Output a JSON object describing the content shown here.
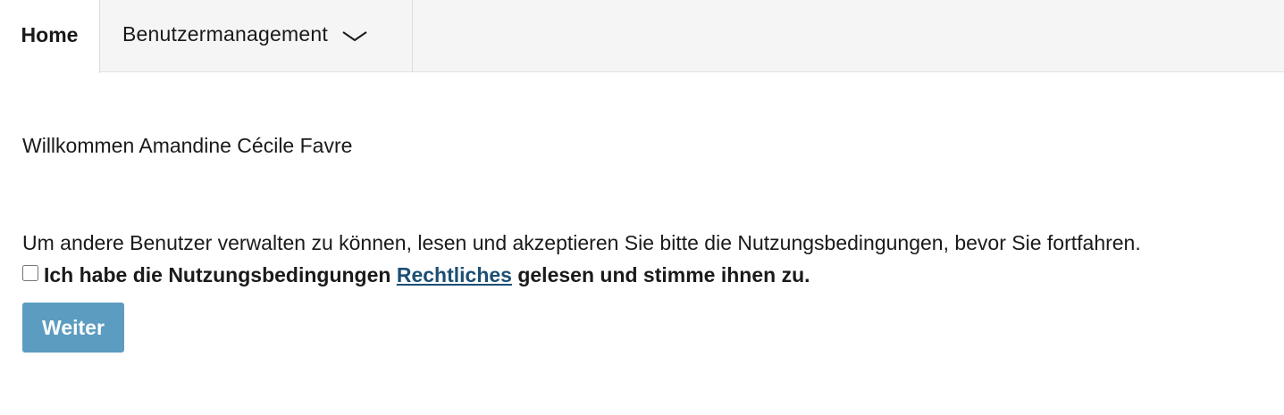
{
  "nav": {
    "home_label": "Home",
    "users_label": "Benutzermanagement",
    "users_icon": "chevron-down-icon"
  },
  "main": {
    "welcome_text": "Willkommen Amandine Cécile Favre",
    "intro_text": "Um andere Benutzer verwalten zu können, lesen und akzeptieren Sie bitte die Nutzungsbedingungen, bevor Sie fortfahren.",
    "consent": {
      "checked": false,
      "text_before": "Ich habe die Nutzungsbedingungen ",
      "link_label": "Rechtliches",
      "text_after": " gelesen und stimme ihnen zu."
    },
    "continue_label": "Weiter"
  },
  "colors": {
    "nav_background": "#f5f5f5",
    "button_background": "#5c9cc0",
    "link": "#1c4f74"
  }
}
